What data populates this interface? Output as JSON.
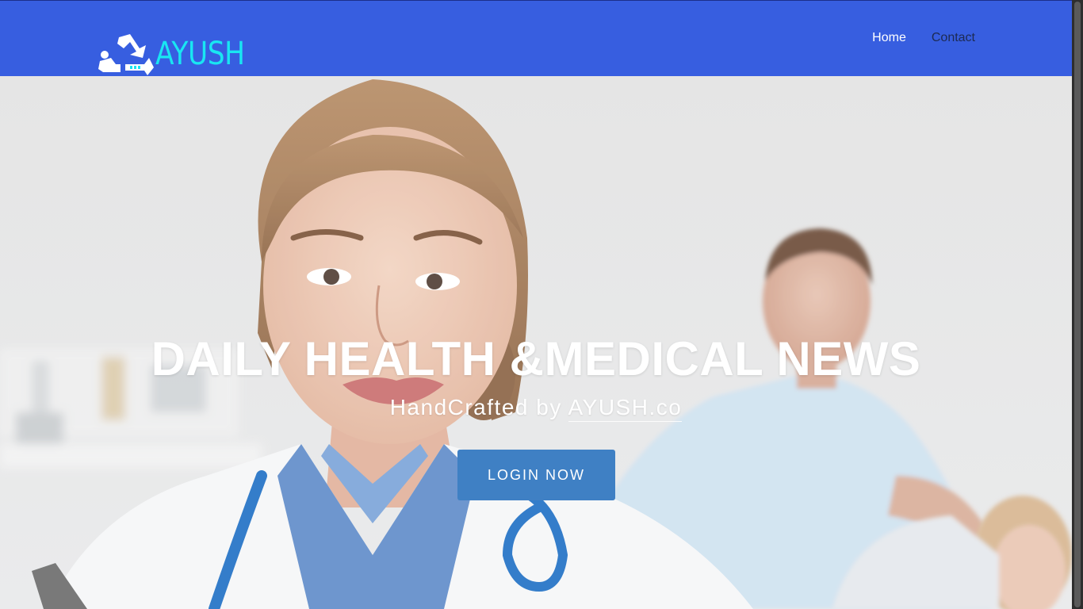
{
  "header": {
    "logo_text": "AYUSH",
    "nav": [
      {
        "label": "Home"
      },
      {
        "label": "Contact"
      }
    ]
  },
  "hero": {
    "title": "DAILY HEALTH &MEDICAL NEWS",
    "subtitle_prefix": "HandCrafted by ",
    "subtitle_link": "AYUSH.co",
    "cta_label": "LOGIN NOW"
  },
  "colors": {
    "navbar": "#375ee0",
    "logo_text": "#19e6f2",
    "button": "#3f80c4"
  },
  "icons": {
    "logo": "recycle-logo-icon"
  }
}
